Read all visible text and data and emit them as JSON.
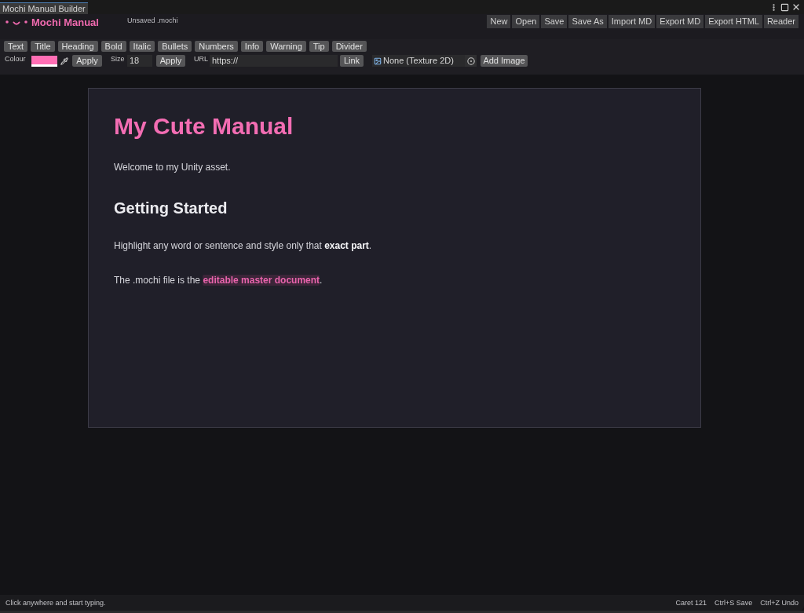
{
  "window": {
    "tab_title": "Mochi Manual Builder"
  },
  "header": {
    "app_name": "Mochi Manual",
    "file_status": "Unsaved .mochi",
    "actions": [
      "New",
      "Open",
      "Save",
      "Save As",
      "Import MD",
      "Export MD",
      "Export HTML",
      "Reader"
    ]
  },
  "format_buttons": [
    "Text",
    "Title",
    "Heading",
    "Bold",
    "Italic",
    "Bullets",
    "Numbers",
    "Info",
    "Warning",
    "Tip",
    "Divider"
  ],
  "style_controls": {
    "colour": {
      "label": "Colour",
      "color": "#ff6eb4",
      "apply": "Apply"
    },
    "size": {
      "label": "Size",
      "value": "18",
      "apply": "Apply"
    },
    "url": {
      "label": "URL",
      "value": "https://",
      "button": "Link"
    },
    "image": {
      "value": "None (Texture 2D)",
      "button": "Add Image"
    }
  },
  "document": {
    "blocks": [
      {
        "kind": "title",
        "text": "My Cute Manual"
      },
      {
        "kind": "paragraph",
        "text": "Welcome to my Unity asset."
      },
      {
        "kind": "heading",
        "text": "Getting Started"
      },
      {
        "kind": "paragraph",
        "text": "Highlight any word or sentence and style only that **exact part**."
      },
      {
        "kind": "paragraph",
        "runs": [
          {
            "kind": "plain",
            "text": "The .mochi file is the "
          },
          {
            "kind": "highlight",
            "text": "editable master document"
          },
          {
            "kind": "plain",
            "text": "."
          }
        ]
      }
    ]
  },
  "status_bar": {
    "hint": "Click anywhere and start typing.",
    "caret": "Caret 121",
    "shortcuts": [
      "Ctrl+S Save",
      "Ctrl+Z Undo"
    ]
  }
}
